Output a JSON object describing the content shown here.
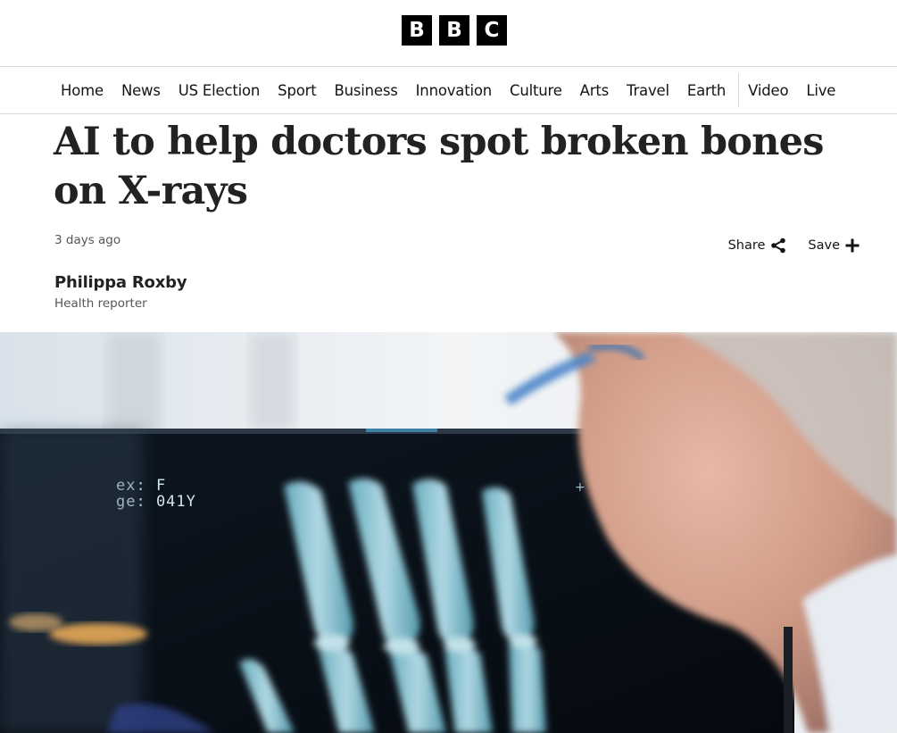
{
  "logo": {
    "letters": [
      "B",
      "B",
      "C"
    ]
  },
  "nav": {
    "items": [
      "Home",
      "News",
      "US Election",
      "Sport",
      "Business",
      "Innovation",
      "Culture",
      "Arts",
      "Travel",
      "Earth",
      "Video",
      "Live"
    ]
  },
  "article": {
    "headline": "AI to help doctors spot broken bones on X-rays",
    "timestamp": "3 days ago",
    "author": "Philippa Roxby",
    "author_role": "Health reporter"
  },
  "actions": {
    "share_label": "Share",
    "save_label": "Save"
  },
  "hero": {
    "description": "photo",
    "xray_line1": "ex:  F",
    "xray_line2": "ge:  041Y"
  },
  "icons": {
    "share": "share-icon",
    "save": "plus-icon"
  }
}
